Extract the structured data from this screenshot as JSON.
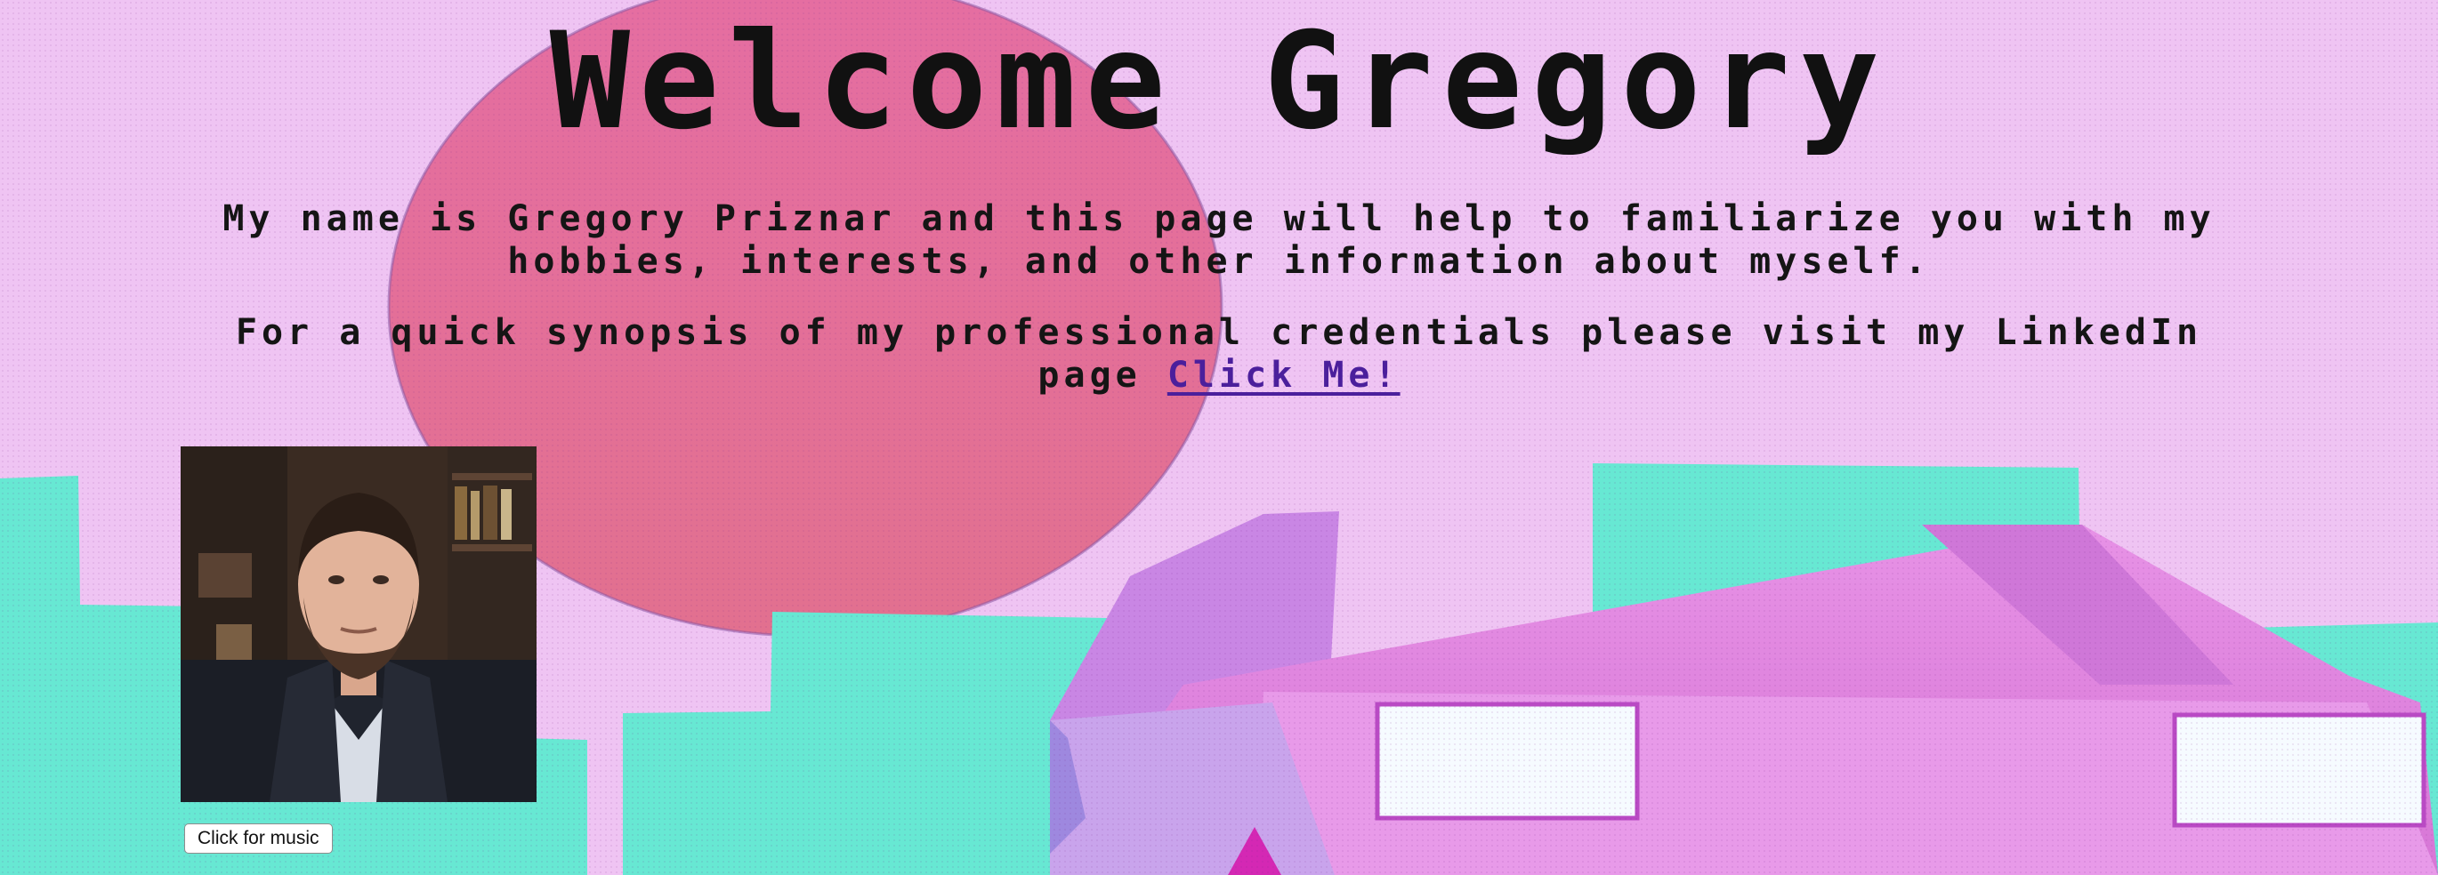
{
  "page": {
    "title": "Welcome Gregory",
    "intro": "My name is Gregory Priznar and this page will help to familiarize you with my hobbies, interests, and other information about myself.",
    "credentials_text": "For a quick synopsis of my professional credentials please visit my LinkedIn page",
    "linkedin_link_label": "Click Me!",
    "music_button_label": "Click for music"
  },
  "colors": {
    "background": "#efc4f3",
    "sun": "#e2709f",
    "buildings": "#67e8d3",
    "car": "#e68ce4",
    "link": "#4b1f9c"
  }
}
